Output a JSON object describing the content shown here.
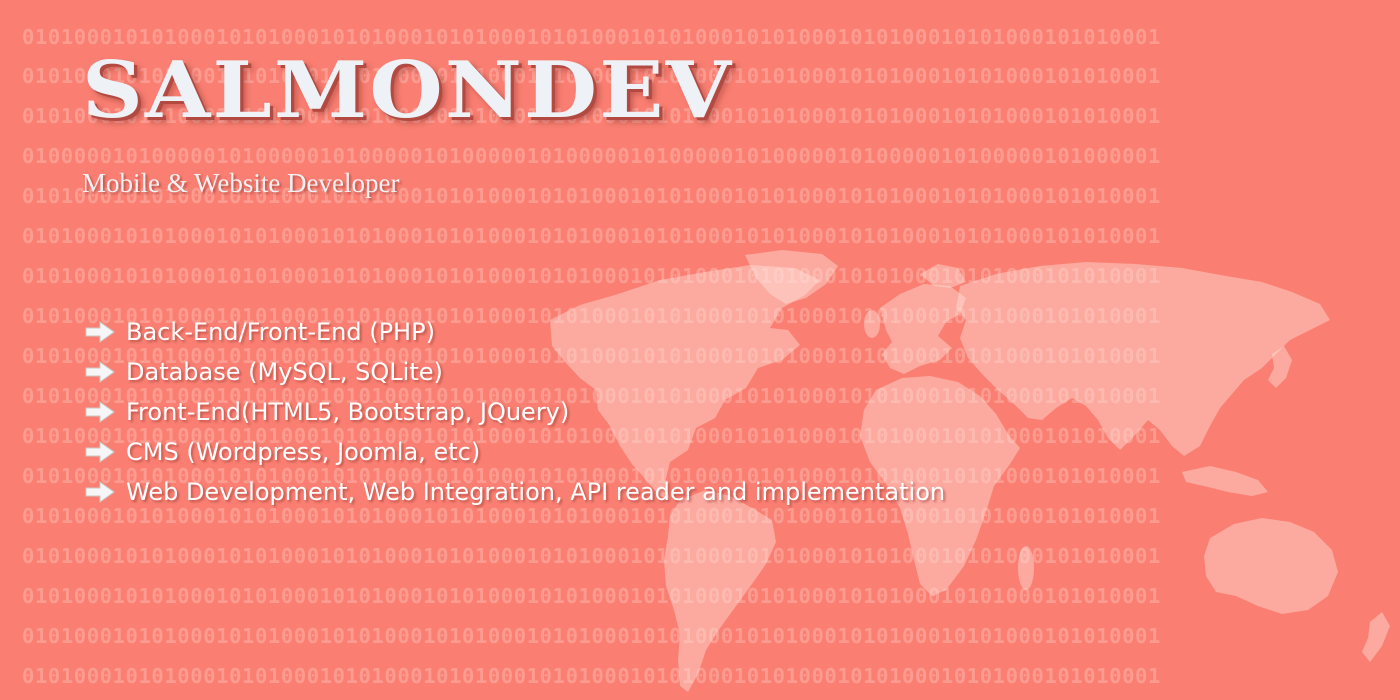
{
  "brand": {
    "title": "SALMONDEV",
    "subtitle": "Mobile & Website Developer"
  },
  "skills": [
    {
      "label": "Back-End/Front-End (PHP)"
    },
    {
      "label": "Database (MySQL, SQLite)"
    },
    {
      "label": "Front-End(HTML5, Bootstrap, JQuery)"
    },
    {
      "label": "CMS (Wordpress, Joomla, etc)"
    },
    {
      "label": "Web Development, Web Integration, API reader and implementation"
    }
  ],
  "background": {
    "binary_pattern": "0101000101010001010100010101000101010001010100010101000101010001010100010101000101010001",
    "binary_pattern_alt": "0100000101000001010000010100000101000001010000010100000101000001010000010100000101000001",
    "color": "#fa7f72",
    "decoration_icon": "world-map-icon"
  },
  "bullet_icon": "arrow-right-icon"
}
